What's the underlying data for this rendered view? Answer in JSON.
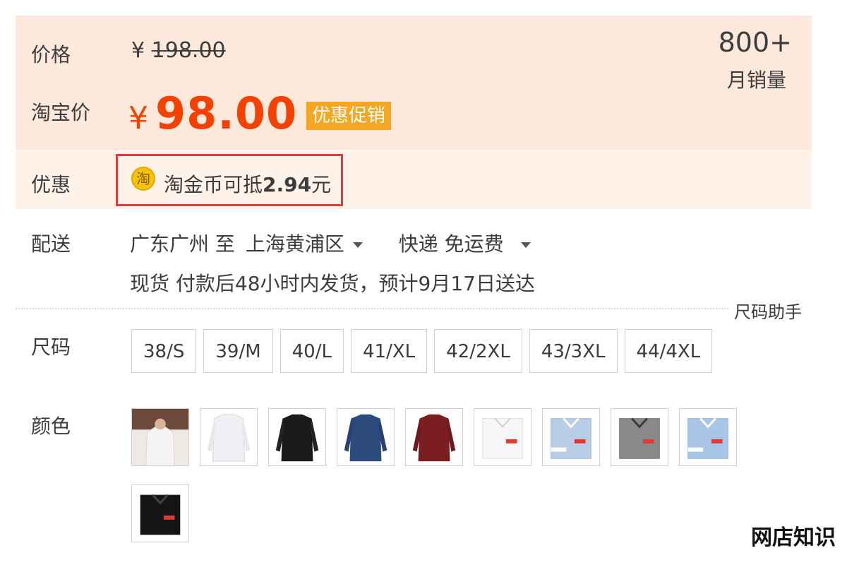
{
  "price": {
    "label": "价格",
    "original_currency": "¥",
    "original_amount": "198.00",
    "taobao_label": "淘宝价",
    "sale_currency": "¥",
    "sale_amount": "98.00",
    "promo_badge": "优惠促销",
    "sales_count": "800+",
    "sales_label": "月销量",
    "accent_color": "#f44100"
  },
  "promotion": {
    "label": "优惠",
    "coin_icon": "淘",
    "coin_text": "淘金币可抵",
    "coin_amount": "2.94",
    "coin_unit": "元"
  },
  "shipping": {
    "label": "配送",
    "from": "广东广州 至",
    "to": "上海黄浦区",
    "method": "快递 免运费",
    "note": "现货 付款后48小时内发货，预计9月17日送达"
  },
  "size": {
    "label": "尺码",
    "guide": "尺码助手",
    "options": [
      "38/S",
      "39/M",
      "40/L",
      "41/XL",
      "42/2XL",
      "43/3XL",
      "44/4XL"
    ]
  },
  "color": {
    "label": "颜色",
    "swatches": [
      {
        "name": "model-white-shirt",
        "color": "#f2f2f2"
      },
      {
        "name": "white-shirt",
        "color": "#eef0f3"
      },
      {
        "name": "black-shirt",
        "color": "#1a1a1a"
      },
      {
        "name": "navy-shirt",
        "color": "#2d4a7c"
      },
      {
        "name": "burgundy-shirt",
        "color": "#7a1e22"
      },
      {
        "name": "white-folded-shirt",
        "color": "#f7f7f7"
      },
      {
        "name": "light-blue-folded-shirt",
        "color": "#b8cde6"
      },
      {
        "name": "grey-folded-shirt",
        "color": "#8a8a8a"
      },
      {
        "name": "sky-blue-folded-shirt",
        "color": "#a9c6e8"
      },
      {
        "name": "black-folded-shirt",
        "color": "#151515"
      }
    ]
  },
  "watermark": "网店知识"
}
